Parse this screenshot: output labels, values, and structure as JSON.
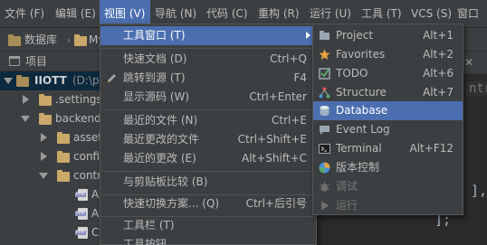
{
  "menubar": {
    "items": [
      "文件 (F)",
      "编辑 (E)",
      "视图 (V)",
      "导航 (N)",
      "代码 (C)",
      "重构 (R)",
      "运行 (U)",
      "工具 (T)",
      "VCS (S)",
      "窗口"
    ],
    "active_index": 2
  },
  "navbar": {
    "crumb1": "数据库",
    "crumb2": "My"
  },
  "project_panel": {
    "header": "项目",
    "rows": [
      {
        "label": "IIOTT",
        "path": "(D:\\pl",
        "arrow": "down",
        "icon": "project-folder-icon"
      },
      {
        "label": ".settings",
        "arrow": "right",
        "icon": "folder-icon"
      },
      {
        "label": "backend",
        "arrow": "down",
        "icon": "folder-icon"
      },
      {
        "label": "asset",
        "arrow": "right",
        "icon": "folder-icon"
      },
      {
        "label": "confi",
        "arrow": "right",
        "icon": "folder-icon"
      },
      {
        "label": "contr",
        "arrow": "down",
        "icon": "folder-icon"
      },
      {
        "label": "A",
        "icon": "php-file-icon"
      },
      {
        "label": "A",
        "icon": "php-file-icon"
      },
      {
        "label": "C",
        "icon": "php-file-icon"
      }
    ]
  },
  "editor": {
    "tab_fragment": "ntr",
    "code_line1": "],",
    "code_line2": "];"
  },
  "view_menu": {
    "items": [
      {
        "label": "工具窗口 (T)",
        "shortcut": "",
        "submenu": true,
        "highlighted": true
      },
      {
        "label": "快速文档 (D)",
        "shortcut": "Ctrl+Q"
      },
      {
        "label": "跳转到源 (T)",
        "shortcut": "F4",
        "icon": "pencil-icon"
      },
      {
        "label": "显示源码 (W)",
        "shortcut": "Ctrl+Enter"
      },
      {
        "label": "最近的文件 (N)",
        "shortcut": "Ctrl+E"
      },
      {
        "label": "最近更改的文件",
        "shortcut": "Ctrl+Shift+E"
      },
      {
        "label": "最近的更改 (E)",
        "shortcut": "Alt+Shift+C"
      },
      {
        "label": "与剪贴板比较 (B)",
        "shortcut": ""
      },
      {
        "label": "快速切换方案... (Q)",
        "shortcut": "Ctrl+后引号"
      },
      {
        "label": "工具栏 (T)",
        "shortcut": ""
      },
      {
        "label": "工具按钮",
        "shortcut": ""
      }
    ]
  },
  "tool_windows_menu": {
    "items": [
      {
        "label": "Project",
        "shortcut": "Alt+1",
        "icon": "project-icon"
      },
      {
        "label": "Favorites",
        "shortcut": "Alt+2",
        "icon": "star-icon"
      },
      {
        "label": "TODO",
        "shortcut": "Alt+6",
        "icon": "todo-icon"
      },
      {
        "label": "Structure",
        "shortcut": "Alt+7",
        "icon": "structure-icon"
      },
      {
        "label": "Database",
        "shortcut": "",
        "icon": "database-icon",
        "highlighted": true
      },
      {
        "label": "Event Log",
        "shortcut": "",
        "icon": "event-log-icon"
      },
      {
        "label": "Terminal",
        "shortcut": "Alt+F12",
        "icon": "terminal-icon"
      },
      {
        "label": "版本控制",
        "shortcut": "",
        "icon": "version-control-icon"
      },
      {
        "label": "调试",
        "shortcut": "",
        "icon": "debug-icon",
        "disabled": true
      },
      {
        "label": "运行",
        "shortcut": "",
        "icon": "run-icon",
        "disabled": true
      }
    ]
  },
  "colors": {
    "background": "#3c3f41",
    "editor": "#2b2b2b",
    "highlight": "#4b6eaf",
    "text": "#bbbbbb"
  }
}
